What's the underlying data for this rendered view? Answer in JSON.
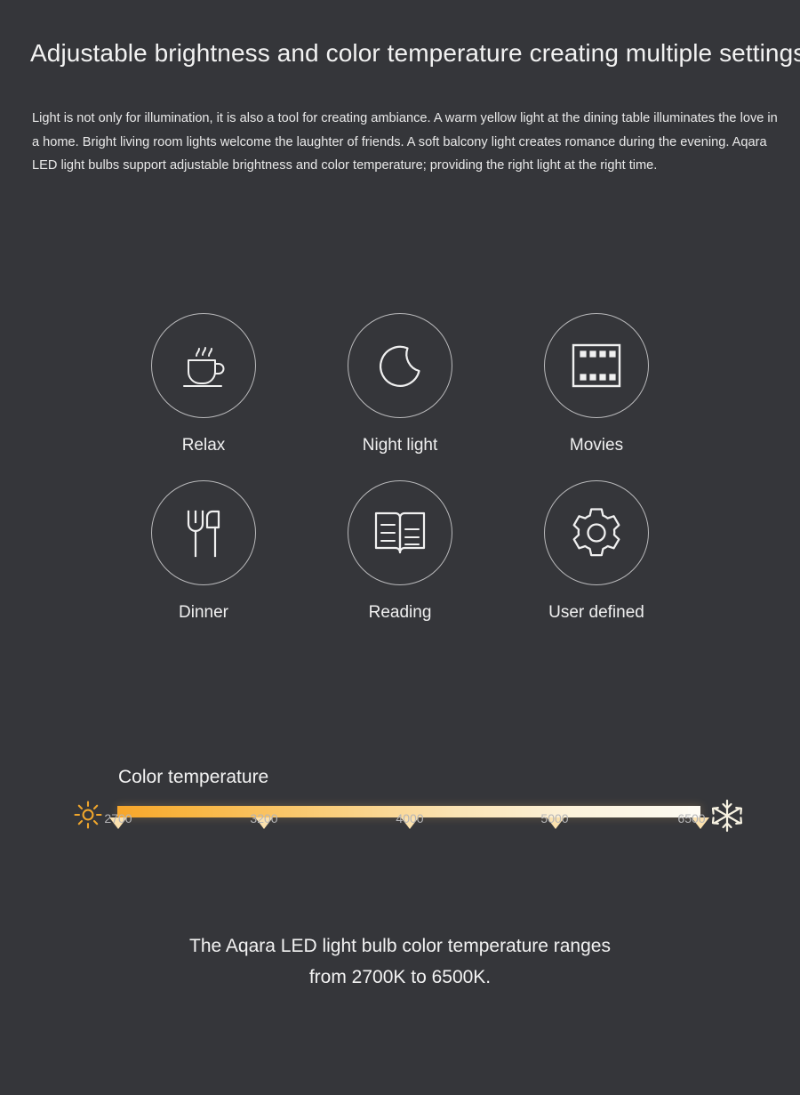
{
  "theme": {
    "background": "#35363a",
    "text_primary": "#f2f2f2",
    "text_muted": "#b5b5b7",
    "stroke": "#b9b9bb",
    "accent_warm": "#f7a62b",
    "accent_cool": "#fefbf3"
  },
  "header": {
    "title": "Adjustable brightness and color temperature creating multiple settings",
    "paragraph": "Light is not only for illumination, it is also a tool for creating ambiance. A warm yellow light at the dining table illuminates the love in a home. Bright living room lights welcome the laughter of friends. A soft balcony light creates romance during the evening. Aqara LED light bulbs support adjustable brightness and color temperature; providing the right light at the right time."
  },
  "scenes": [
    {
      "label": "Relax",
      "icon": "coffee-cup-icon"
    },
    {
      "label": "Night light",
      "icon": "crescent-moon-icon"
    },
    {
      "label": "Movies",
      "icon": "film-strip-icon"
    },
    {
      "label": "Dinner",
      "icon": "fork-and-knife-icon"
    },
    {
      "label": "Reading",
      "icon": "open-book-icon"
    },
    {
      "label": "User defined",
      "icon": "gear-icon"
    }
  ],
  "color_temperature": {
    "heading": "Color temperature",
    "warm_icon": "sun-icon",
    "cool_icon": "snowflake-icon",
    "ticks": [
      "2700",
      "3200",
      "4000",
      "5000",
      "6500"
    ],
    "range_min": "2700K",
    "range_max": "6500K",
    "caption_line_1": "The Aqara LED light bulb color temperature ranges",
    "caption_line_2": "from 2700K to 6500K."
  }
}
